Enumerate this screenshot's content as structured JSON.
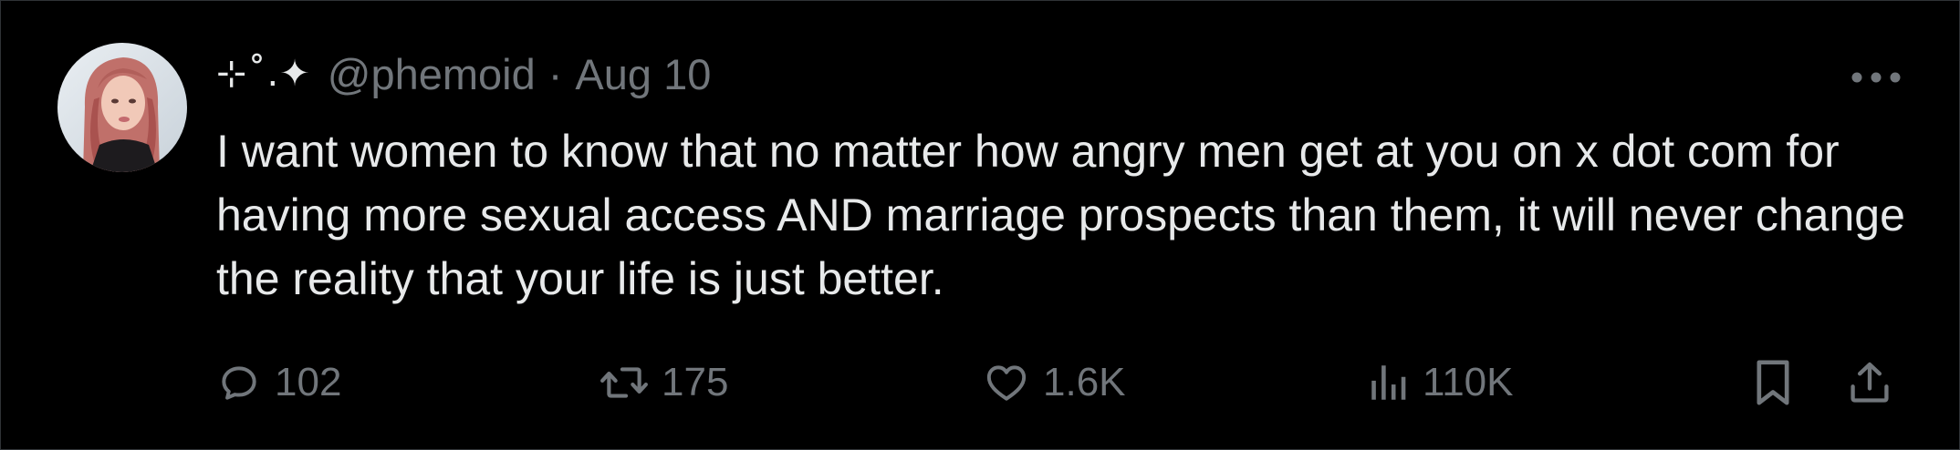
{
  "tweet": {
    "author": {
      "display_name": "⊹˚.✦",
      "handle": "@phemoid",
      "avatar_icon": "avatar-photo"
    },
    "separator": "·",
    "date": "Aug 10",
    "text": "I want women to know that no matter how angry men get at you on x dot com for having more sexual access AND marriage prospects than them, it will never change the reality that your life is just better.",
    "more_icon": "more-horizontal-icon"
  },
  "actions": {
    "reply": {
      "icon": "reply-icon",
      "count": "102"
    },
    "retweet": {
      "icon": "retweet-icon",
      "count": "175"
    },
    "like": {
      "icon": "heart-icon",
      "count": "1.6K"
    },
    "views": {
      "icon": "views-icon",
      "count": "110K"
    },
    "bookmark": {
      "icon": "bookmark-icon"
    },
    "share": {
      "icon": "share-icon"
    }
  },
  "colors": {
    "background": "#000000",
    "text_primary": "#e7e9ea",
    "text_secondary": "#71767b",
    "border": "#2f3336"
  }
}
